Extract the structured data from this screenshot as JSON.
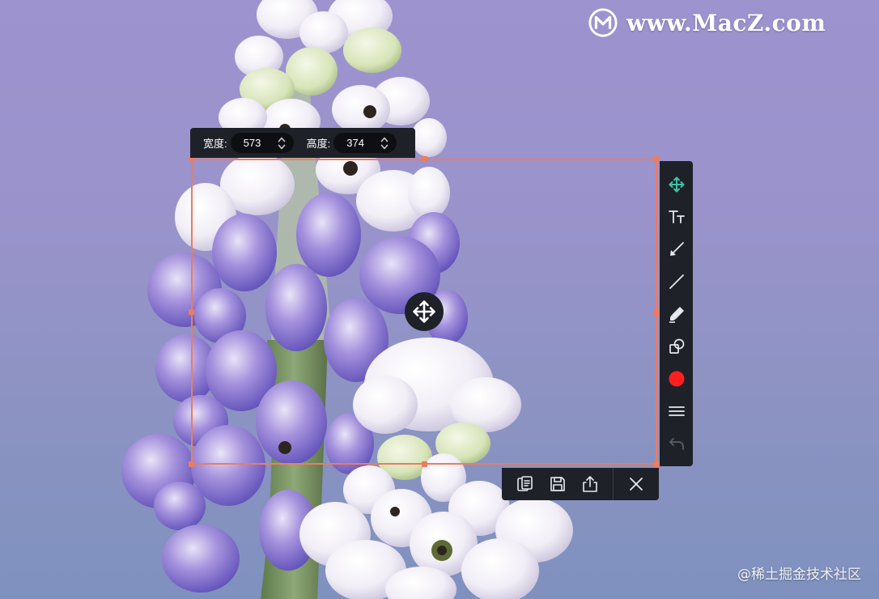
{
  "watermark": {
    "logo_icon": "macz-logo-icon",
    "text": "www.MacZ.com"
  },
  "credit": "@稀土掘金技术社区",
  "size_bar": {
    "width_label": "宽度:",
    "width_value": "573",
    "height_label": "高度:",
    "height_value": "374"
  },
  "selection": {
    "border_color": "#ee7b5f"
  },
  "move_cursor": {
    "icon": "move-arrows-icon"
  },
  "vertical_toolbar": {
    "tools": [
      {
        "name": "move-tool",
        "icon": "move-arrows-icon",
        "active": true,
        "color": "#3cc3a6"
      },
      {
        "name": "text-tool",
        "icon": "text-size-icon"
      },
      {
        "name": "arrow-tool",
        "icon": "arrow-icon"
      },
      {
        "name": "line-tool",
        "icon": "line-icon"
      },
      {
        "name": "marker-tool",
        "icon": "marker-icon"
      },
      {
        "name": "shape-tool",
        "icon": "shapes-icon"
      },
      {
        "name": "color-picker",
        "icon": "color-dot-icon",
        "color": "#ff1f1f"
      },
      {
        "name": "stroke-width",
        "icon": "lines-icon"
      },
      {
        "name": "undo",
        "icon": "undo-icon",
        "disabled": true
      }
    ]
  },
  "action_bar": {
    "buttons": [
      {
        "name": "copy-button",
        "icon": "copy-icon"
      },
      {
        "name": "save-button",
        "icon": "save-icon"
      },
      {
        "name": "share-button",
        "icon": "share-icon"
      },
      {
        "name": "close-button",
        "icon": "close-icon"
      }
    ]
  }
}
